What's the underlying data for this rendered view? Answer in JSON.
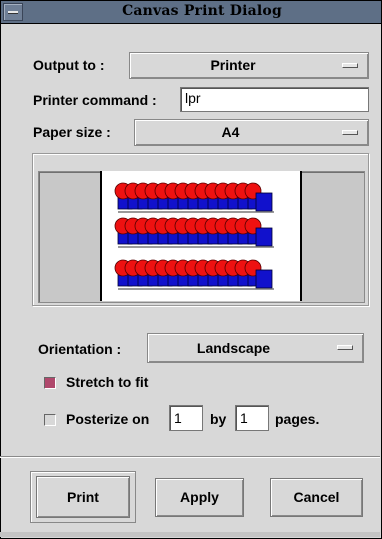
{
  "window": {
    "title": "Canvas Print Dialog"
  },
  "output": {
    "label": "Output to :",
    "value": "Printer"
  },
  "printer_command": {
    "label": "Printer command :",
    "value": "lpr"
  },
  "paper_size": {
    "label": "Paper size :",
    "value": "A4"
  },
  "preview": {
    "rows": 3,
    "shapes_per_row": 14,
    "colors": {
      "circle": "#ee1111",
      "square": "#1111cc",
      "paper": "#ffffff",
      "background": "#c8c8c8"
    }
  },
  "orientation": {
    "label": "Orientation :",
    "value": "Landscape"
  },
  "stretch": {
    "label": "Stretch to fit",
    "checked": true
  },
  "posterize": {
    "label_on": "Posterize on",
    "value_x": "1",
    "label_by": "by",
    "value_y": "1",
    "label_pages": "pages.",
    "checked": false
  },
  "buttons": {
    "print": "Print",
    "apply": "Apply",
    "cancel": "Cancel"
  },
  "colors": {
    "title_bar": "#5e6f86",
    "dialog_bg": "#d8d8d8",
    "check_on": "#b0486c"
  }
}
